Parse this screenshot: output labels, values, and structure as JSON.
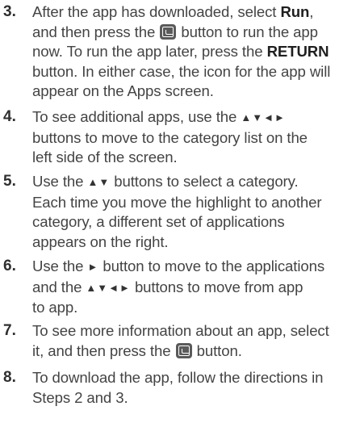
{
  "steps": [
    {
      "number": "3.",
      "lines": [
        [
          "After the app has downloaded, select ",
          "Run",
          ","
        ],
        [
          "and then press the ",
          "[enter-icon]",
          " button to run the app"
        ],
        [
          "now. To run the app later, press the ",
          "RETURN"
        ],
        [
          "button. In either case, the icon for the app will"
        ],
        [
          "appear on the Apps screen."
        ]
      ]
    },
    {
      "number": "4.",
      "lines": [
        [
          "To see additional apps, use the ",
          "▲▼◄►"
        ],
        [
          "buttons to move to the category list on the"
        ],
        [
          "left side of the screen."
        ]
      ]
    },
    {
      "number": "5.",
      "lines": [
        [
          "Use the ",
          "▲▼",
          " buttons to select a category."
        ],
        [
          "Each time you move the highlight to another"
        ],
        [
          "category, a different set of applications"
        ],
        [
          "appears on the right."
        ]
      ]
    },
    {
      "number": "6.",
      "lines": [
        [
          "Use the ",
          "►",
          " button to move to the applications"
        ],
        [
          "and the ",
          "▲▼◄►",
          " buttons to move from app"
        ],
        [
          "to app."
        ]
      ]
    },
    {
      "number": "7.",
      "lines": [
        [
          "To see more information about an app, select"
        ],
        [
          "it, and then press the ",
          "[enter-icon]",
          " button."
        ]
      ]
    },
    {
      "number": "8.",
      "lines": [
        [
          "To download the app, follow the directions in"
        ],
        [
          "Steps 2 and 3."
        ]
      ]
    }
  ],
  "step3": {
    "number": "3.",
    "l1_a": "After the app has downloaded, select ",
    "l1_b": "Run",
    "l1_c": ",",
    "l2_a": "and then press the ",
    "l2_b": " button to run the app",
    "l3_a": "now. To run the app later, press the ",
    "l3_b": "RETURN",
    "l4": "button. In either case, the icon for the app will",
    "l5": "appear on the Apps screen."
  },
  "step4": {
    "number": "4.",
    "l1_a": "To see additional apps, use the ",
    "l1_arrows": "▲▼◄►",
    "l2": "buttons to move to the category list on the",
    "l3": "left side of the screen."
  },
  "step5": {
    "number": "5.",
    "l1_a": "Use the ",
    "l1_arrows": "▲▼",
    "l1_b": " buttons to select a category.",
    "l2": "Each time you move the highlight to another",
    "l3": "category, a different set of applications",
    "l4": "appears on the right."
  },
  "step6": {
    "number": "6.",
    "l1_a": "Use the ",
    "l1_arrow": "►",
    "l1_b": " button to move to the applications",
    "l2_a": "and the ",
    "l2_arrows": "▲▼◄►",
    "l2_b": " buttons to move from app",
    "l3": "to app."
  },
  "step7": {
    "number": "7.",
    "l1": "To see more information about an app, select",
    "l2_a": "it, and then press the ",
    "l2_b": " button."
  },
  "step8": {
    "number": "8.",
    "l1": "To download the app, follow the directions in",
    "l2": "Steps 2 and 3."
  },
  "icons": {
    "enter": "enter-button-icon",
    "arrows": "arrow-buttons"
  }
}
